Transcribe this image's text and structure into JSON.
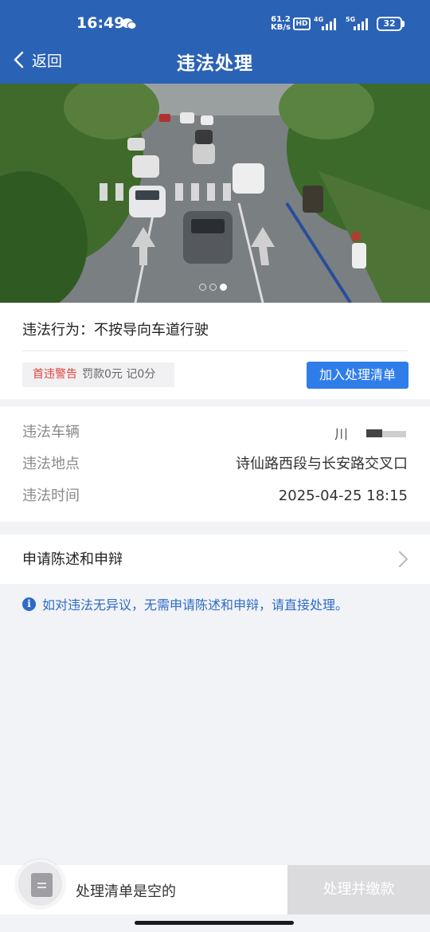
{
  "status_bar": {
    "time": "16:49",
    "net_speed_value": "61.2",
    "net_speed_unit": "KB/s",
    "hd_label": "HD",
    "sim1_label": "4G",
    "sim2_label": "5G",
    "battery": "32"
  },
  "header": {
    "back_label": "返回",
    "title": "违法处理"
  },
  "violation": {
    "behavior_label": "违法行为：",
    "behavior_value": "不按导向车道行驶",
    "first_warning": "首违警告",
    "penalty_detail": "罚款0元 记0分",
    "add_button": "加入处理清单"
  },
  "details": {
    "vehicle_label": "违法车辆",
    "vehicle_value_visible": "川",
    "location_label": "违法地点",
    "location_value": "诗仙路西段与长安路交叉口",
    "time_label": "违法时间",
    "time_value": "2025-04-25 18:15"
  },
  "appeal": {
    "label": "申请陈述和申辩"
  },
  "notice": {
    "text": "如对违法无异议，无需申请陈述和申辩，请直接处理。"
  },
  "bottom_bar": {
    "cart_empty_text": "处理清单是空的",
    "pay_button": "处理并缴款"
  },
  "colors": {
    "header_bg": "#2a62b6",
    "primary_button": "#2f7de8",
    "warning_red": "#e0453c",
    "notice_blue": "#2d6bc6",
    "disabled_button": "#dbdbdd"
  },
  "carousel": {
    "dot_count": 3,
    "active_index": 2
  }
}
